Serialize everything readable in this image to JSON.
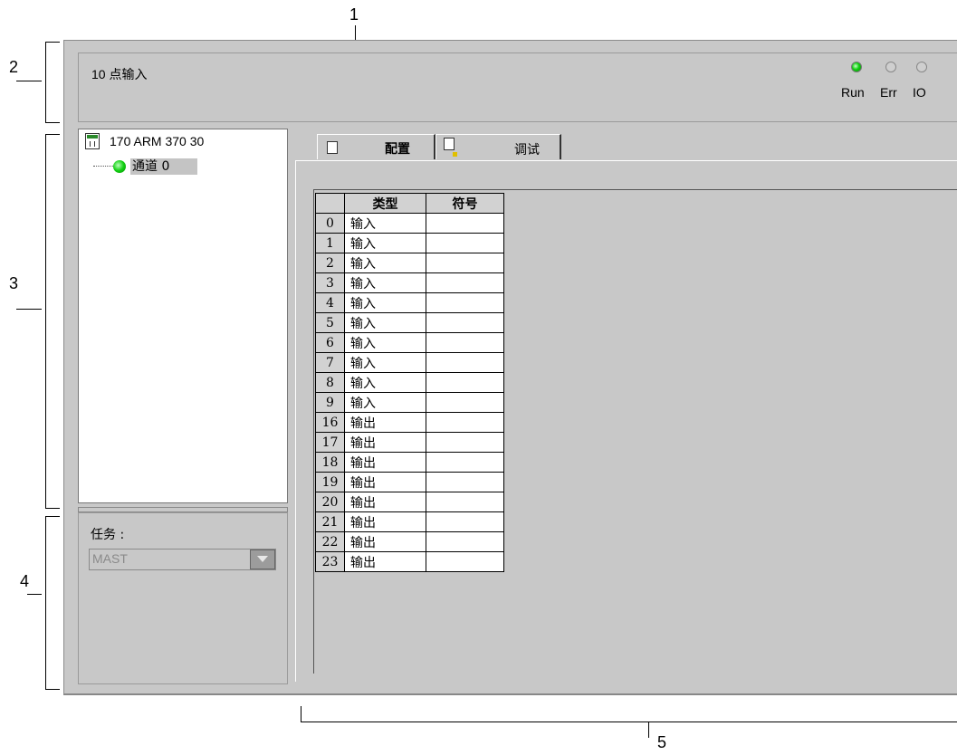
{
  "callouts": [
    "1",
    "2",
    "3",
    "4",
    "5"
  ],
  "header": {
    "module_title": "10 点输入",
    "leds": [
      {
        "label": "Run",
        "state": "on",
        "color": "#14c814"
      },
      {
        "label": "Err",
        "state": "off",
        "color": "#cfcfcf"
      },
      {
        "label": "IO",
        "state": "off",
        "color": "#cfcfcf"
      }
    ]
  },
  "tree": {
    "module_name": "170 ARM 370 30",
    "channel_label": "通道 0"
  },
  "task": {
    "label": "任务 :",
    "value": "MAST"
  },
  "tabs": [
    {
      "label": "配置",
      "active": true
    },
    {
      "label": "调试",
      "active": false
    }
  ],
  "table": {
    "headers": [
      "类型",
      "符号"
    ],
    "rows": [
      {
        "num": "0",
        "type": "输入",
        "symbol": ""
      },
      {
        "num": "1",
        "type": "输入",
        "symbol": ""
      },
      {
        "num": "2",
        "type": "输入",
        "symbol": ""
      },
      {
        "num": "3",
        "type": "输入",
        "symbol": ""
      },
      {
        "num": "4",
        "type": "输入",
        "symbol": ""
      },
      {
        "num": "5",
        "type": "输入",
        "symbol": ""
      },
      {
        "num": "6",
        "type": "输入",
        "symbol": ""
      },
      {
        "num": "7",
        "type": "输入",
        "symbol": ""
      },
      {
        "num": "8",
        "type": "输入",
        "symbol": ""
      },
      {
        "num": "9",
        "type": "输入",
        "symbol": ""
      },
      {
        "num": "16",
        "type": "输出",
        "symbol": ""
      },
      {
        "num": "17",
        "type": "输出",
        "symbol": ""
      },
      {
        "num": "18",
        "type": "输出",
        "symbol": ""
      },
      {
        "num": "19",
        "type": "输出",
        "symbol": ""
      },
      {
        "num": "20",
        "type": "输出",
        "symbol": ""
      },
      {
        "num": "21",
        "type": "输出",
        "symbol": ""
      },
      {
        "num": "22",
        "type": "输出",
        "symbol": ""
      },
      {
        "num": "23",
        "type": "输出",
        "symbol": ""
      }
    ]
  }
}
